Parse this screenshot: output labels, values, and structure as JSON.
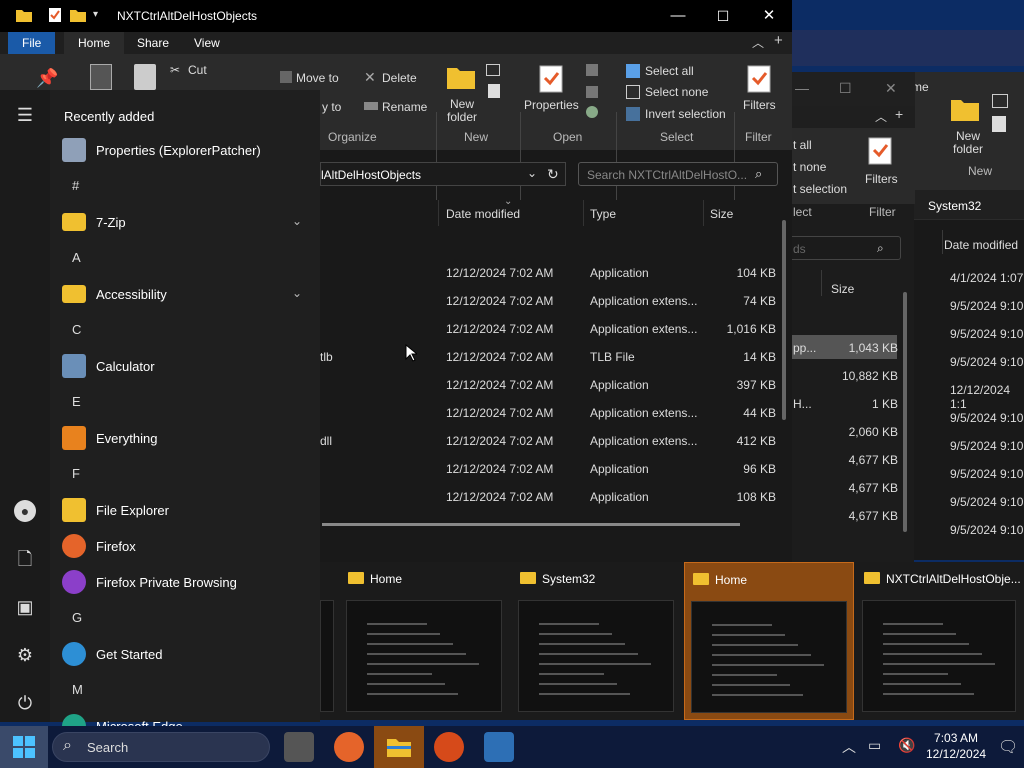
{
  "main_window": {
    "title": "NXTCtrlAltDelHostObjects",
    "tabs": [
      "File",
      "Home",
      "Share",
      "View"
    ],
    "ribbon": {
      "cut": "Cut",
      "move_to": "Move to",
      "copy_to": "y to",
      "delete": "Delete",
      "rename": "Rename",
      "new_folder": "New folder",
      "properties": "Properties",
      "select_all": "Select all",
      "select_none": "Select none",
      "invert_selection": "Invert selection",
      "filters": "Filters",
      "groups": [
        "Organize",
        "New",
        "Open",
        "Select",
        "Filter"
      ]
    },
    "address": "lAltDelHostObjects",
    "search_placeholder": "Search NXTCtrlAltDelHostO...",
    "columns": [
      "Date modified",
      "Type",
      "Size"
    ],
    "rows": [
      {
        "name": "",
        "date": "12/12/2024 7:02 AM",
        "type": "Application",
        "size": "104 KB"
      },
      {
        "name": "",
        "date": "12/12/2024 7:02 AM",
        "type": "Application extens...",
        "size": "74 KB"
      },
      {
        "name": "",
        "date": "12/12/2024 7:02 AM",
        "type": "Application extens...",
        "size": "1,016 KB"
      },
      {
        "name": "tlb",
        "date": "12/12/2024 7:02 AM",
        "type": "TLB File",
        "size": "14 KB"
      },
      {
        "name": "",
        "date": "12/12/2024 7:02 AM",
        "type": "Application",
        "size": "397 KB"
      },
      {
        "name": "",
        "date": "12/12/2024 7:02 AM",
        "type": "Application extens...",
        "size": "44 KB"
      },
      {
        "name": "dll",
        "date": "12/12/2024 7:02 AM",
        "type": "Application extens...",
        "size": "412 KB"
      },
      {
        "name": "",
        "date": "12/12/2024 7:02 AM",
        "type": "Application",
        "size": "96 KB"
      },
      {
        "name": "",
        "date": "12/12/2024 7:02 AM",
        "type": "Application",
        "size": "108 KB"
      }
    ]
  },
  "bg_window_1": {
    "select_all": "t all",
    "select_none": "t none",
    "invert": "t selection",
    "select_group": "lect",
    "filters": "Filters",
    "filter_group": "Filter",
    "search_frag": "ds",
    "size_header": "Size",
    "highlight_type": "pp...",
    "h_frag": "H...",
    "sizes": [
      "1,043 KB",
      "10,882 KB",
      "1 KB",
      "2,060 KB",
      "4,677 KB",
      "4,677 KB",
      "4,677 KB"
    ]
  },
  "bg_window_2": {
    "new_folder": "New folder",
    "new_group": "New",
    "me_frag": "me",
    "crumb": "System32",
    "date_header": "Date modified",
    "dates": [
      "4/1/2024 1:07",
      "9/5/2024 9:10",
      "9/5/2024 9:10",
      "9/5/2024 9:10",
      "12/12/2024 1:1",
      "9/5/2024 9:10",
      "9/5/2024 9:10",
      "9/5/2024 9:10",
      "9/5/2024 9:10",
      "9/5/2024 9:10"
    ]
  },
  "start_menu": {
    "recent_heading": "Recently added",
    "items": [
      {
        "type": "app",
        "label": "Properties (ExplorerPatcher)",
        "icon": "properties-icon",
        "color": "#8fa0b8"
      },
      {
        "type": "letter",
        "label": "#"
      },
      {
        "type": "app",
        "label": "7-Zip",
        "icon": "folder-icon",
        "color": "#f0c030",
        "chevron": true
      },
      {
        "type": "letter",
        "label": "A"
      },
      {
        "type": "app",
        "label": "Accessibility",
        "icon": "folder-icon",
        "color": "#f0c030",
        "chevron": true
      },
      {
        "type": "letter",
        "label": "C"
      },
      {
        "type": "app",
        "label": "Calculator",
        "icon": "calculator-icon",
        "color": "#6a8fb8"
      },
      {
        "type": "letter",
        "label": "E"
      },
      {
        "type": "app",
        "label": "Everything",
        "icon": "everything-icon",
        "color": "#e8821e"
      },
      {
        "type": "letter",
        "label": "F"
      },
      {
        "type": "app",
        "label": "File Explorer",
        "icon": "file-explorer-icon",
        "color": "#f0c030"
      },
      {
        "type": "app",
        "label": "Firefox",
        "icon": "firefox-icon",
        "color": "#e5642a"
      },
      {
        "type": "app",
        "label": "Firefox Private Browsing",
        "icon": "firefox-private-icon",
        "color": "#8b3fc9"
      },
      {
        "type": "letter",
        "label": "G"
      },
      {
        "type": "app",
        "label": "Get Started",
        "icon": "get-started-icon",
        "color": "#2d8fd5"
      },
      {
        "type": "letter",
        "label": "M"
      },
      {
        "type": "app",
        "label": "Microsoft Edge",
        "icon": "edge-icon",
        "color": "#1fa387"
      }
    ]
  },
  "task_view": [
    {
      "title": "Home",
      "active": false
    },
    {
      "title": "System32",
      "active": false
    },
    {
      "title": "Home",
      "active": true
    },
    {
      "title": "NXTCtrlAltDelHostObje...",
      "active": false
    }
  ],
  "taskbar": {
    "search_label": "Search",
    "time": "7:03 AM",
    "date": "12/12/2024"
  }
}
